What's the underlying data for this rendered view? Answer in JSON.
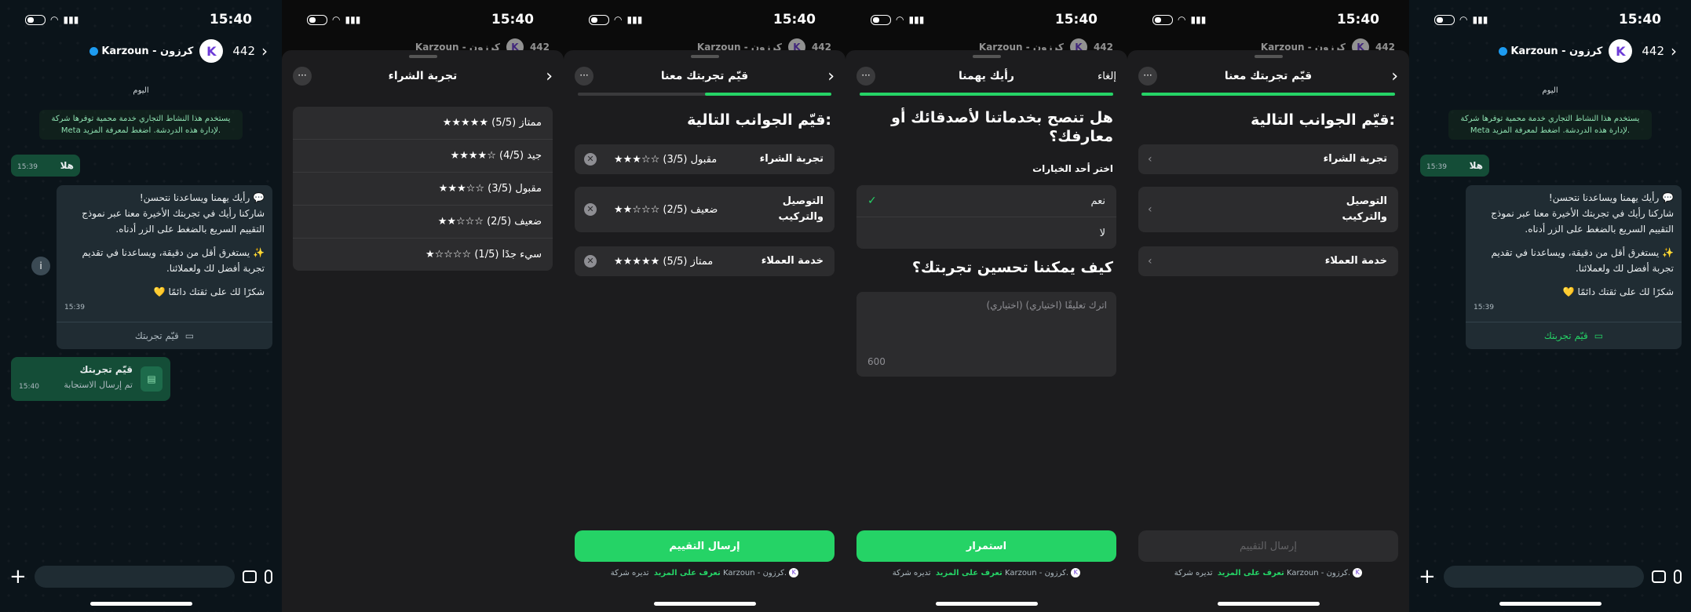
{
  "status": {
    "time": "15:40"
  },
  "chat": {
    "header_name": "Karzoun - كرزون",
    "unread_count": "442",
    "date_label": "اليوم",
    "system_notice": "يستخدم هذا النشاط التجاري خدمة محمية توفرها شركة Meta لإدارة هذه الدردشة. اضغط لمعرفة المزيد.",
    "hello_text": "هلا",
    "hello_time": "15:39",
    "survey_lines": [
      "💬 رأيك يهمنا ويساعدنا نتحسن!",
      "شاركنا رأيك في تجربتك الأخيرة معنا عبر نموذج",
      "التقييم السريع بالضغط على الزر أدناه.",
      "",
      "✨ يستغرق أقل من دقيقة، ويساعدنا في تقديم",
      "تجربة أفضل لك ولعملائنا.",
      "",
      "شكرًا لك على ثقتك دائمًا 💛"
    ],
    "survey_time": "15:39",
    "survey_button": "قيّم تجربتك",
    "reply_title": "قيّم تجربتك",
    "reply_sub": "تم إرسال الاستجابة",
    "reply_time": "15:40"
  },
  "panel2": {
    "title": "تجربة الشراء",
    "options": [
      "★★★★★ ممتاز (5/5)",
      "★★★★☆ جيد (4/5)",
      "★★★☆☆ مقبول (3/5)",
      "★★☆☆☆ ضعيف (2/5)",
      "★☆☆☆☆ سيء جدًا (1/5)"
    ]
  },
  "panel3": {
    "title": "قيّم تجربتك معنا",
    "heading": "قيّم الجوانب التالية:",
    "aspects": [
      {
        "label": "تجربة الشراء",
        "value": "★★★☆☆ مقبول (3/5)"
      },
      {
        "label": "التوصيل والتركيب",
        "value": "★★☆☆☆ ضعيف (2/5)"
      },
      {
        "label": "خدمة العملاء",
        "value": "★★★★★ ممتاز (5/5)"
      }
    ],
    "submit": "إرسال التقييم",
    "progress": 0.5
  },
  "panel4": {
    "title": "رأيك يهمنا",
    "cancel": "إلغاء",
    "question": "هل تنصح بخدماتنا لأصدقائك أو معارفك؟",
    "choose": "اختر أحد الخيارات",
    "options": [
      "نعم",
      "لا"
    ],
    "selected": "نعم",
    "question2": "كيف يمكننا تحسين تجربتك؟",
    "placeholder": "اترك تعليقًا (اختياري) (اختياري)",
    "char_count": "600",
    "continue": "استمرار",
    "progress": 1.0
  },
  "panel5": {
    "title": "قيّم تجربتك معنا",
    "heading": "قيّم الجوانب التالية:",
    "aspects": [
      "تجربة الشراء",
      "التوصيل والتركيب",
      "خدمة العملاء"
    ],
    "submit": "إرسال التقييم",
    "progress": 1.0
  },
  "footer": {
    "text": "تديره شركة Karzoun - كرزون.",
    "learn_more": "تعرف على المزيد"
  },
  "colors": {
    "accent": "#25d366",
    "bubble_out": "#144d37",
    "bubble_in": "#202c33",
    "sheet": "#1c1c1e",
    "card": "#2c2c2e"
  }
}
